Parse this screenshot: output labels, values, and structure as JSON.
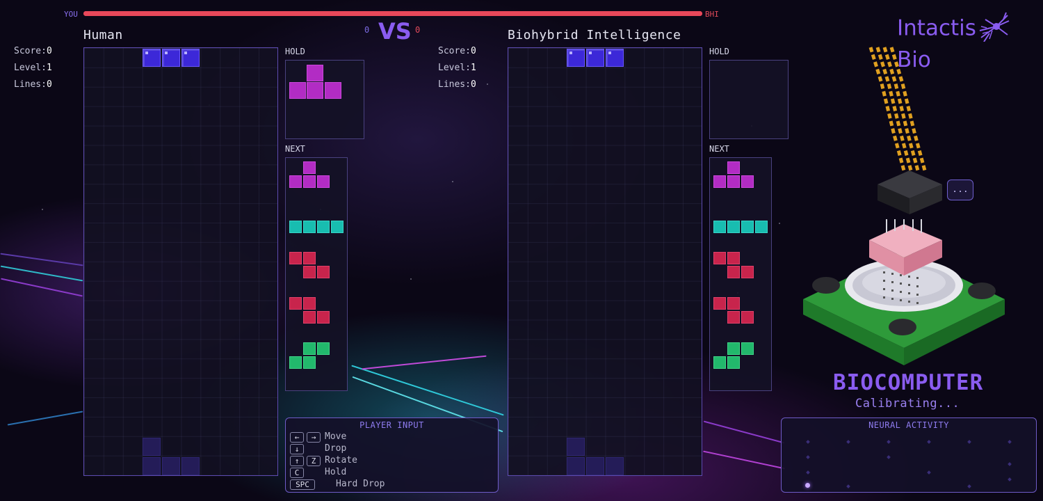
{
  "top_bar": {
    "you_label": "YOU",
    "opponent_label": "BHI",
    "player_health_fraction": 1.0,
    "player_color": "#e8485a"
  },
  "versus": {
    "label": "VS",
    "human_score": "0",
    "bhi_score": "0"
  },
  "human": {
    "name": "Human",
    "score_label": "Score:",
    "score": "0",
    "level_label": "Level:",
    "level": "1",
    "lines_label": "Lines:",
    "lines": "0",
    "hold_label": "HOLD",
    "hold_piece": "T",
    "next_label": "NEXT",
    "next_pieces": [
      "T",
      "I",
      "Z",
      "Z",
      "S"
    ],
    "active_piece": "J",
    "ghost_piece": "J"
  },
  "bhi": {
    "name": "Biohybrid Intelligence",
    "score_label": "Score:",
    "score": "0",
    "level_label": "Level:",
    "level": "1",
    "lines_label": "Lines:",
    "lines": "0",
    "hold_label": "HOLD",
    "hold_piece": "",
    "next_label": "NEXT",
    "next_pieces": [
      "T",
      "I",
      "Z",
      "Z",
      "S"
    ],
    "active_piece": "J",
    "ghost_piece": "J"
  },
  "piece_colors": {
    "J": "#3c28d8",
    "T": "#b22cc4",
    "I": "#18bdb0",
    "Z": "#c8244c",
    "S": "#22b86c"
  },
  "player_input": {
    "title": "PLAYER INPUT",
    "keys": {
      "left": "←",
      "right": "→",
      "down": "↓",
      "up": "↑",
      "z": "Z",
      "c": "C",
      "space": "SPC"
    },
    "actions": {
      "move": "Move",
      "drop": "Drop",
      "rotate": "Rotate",
      "hold": "Hold",
      "hard_drop": "Hard Drop"
    }
  },
  "brand": {
    "logo_left": "Intactis",
    "logo_right": "Bio",
    "logo_icon": "neuron-icon"
  },
  "biocomputer": {
    "title": "BIOCOMPUTER",
    "status": "Calibrating...",
    "speech_bubble": "...",
    "accent": "#8a5cf0"
  },
  "neural_activity": {
    "title": "NEURAL ACTIVITY"
  }
}
